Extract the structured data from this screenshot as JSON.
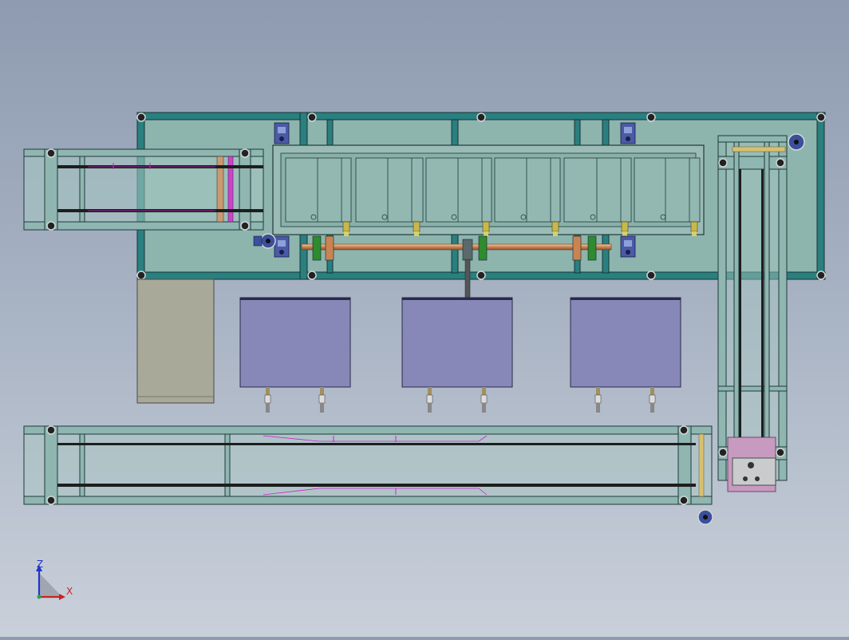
{
  "scene": {
    "colors": {
      "frame_fill": "#8fb6b0",
      "frame_stroke": "#1f3a3a",
      "beam_dark": "#1d6b6b",
      "panel_fill": "#8aa9a4",
      "tank_fill": "#8888b8",
      "cabinet_fill": "#a8a89a",
      "magenta": "#cc22cc",
      "rod": "#d08a5a",
      "pink_block": "#c79ac0",
      "motor": "#3b4f9a",
      "green_part": "#2e8b2e",
      "nozzle": "#c9b84a"
    },
    "icons": [
      "gear-motor-icon",
      "wheel-icon",
      "nozzle-icon"
    ]
  },
  "triad": {
    "z_label": "Z",
    "x_label": "X",
    "z_color": "#2233cc",
    "x_color": "#cc2222"
  }
}
